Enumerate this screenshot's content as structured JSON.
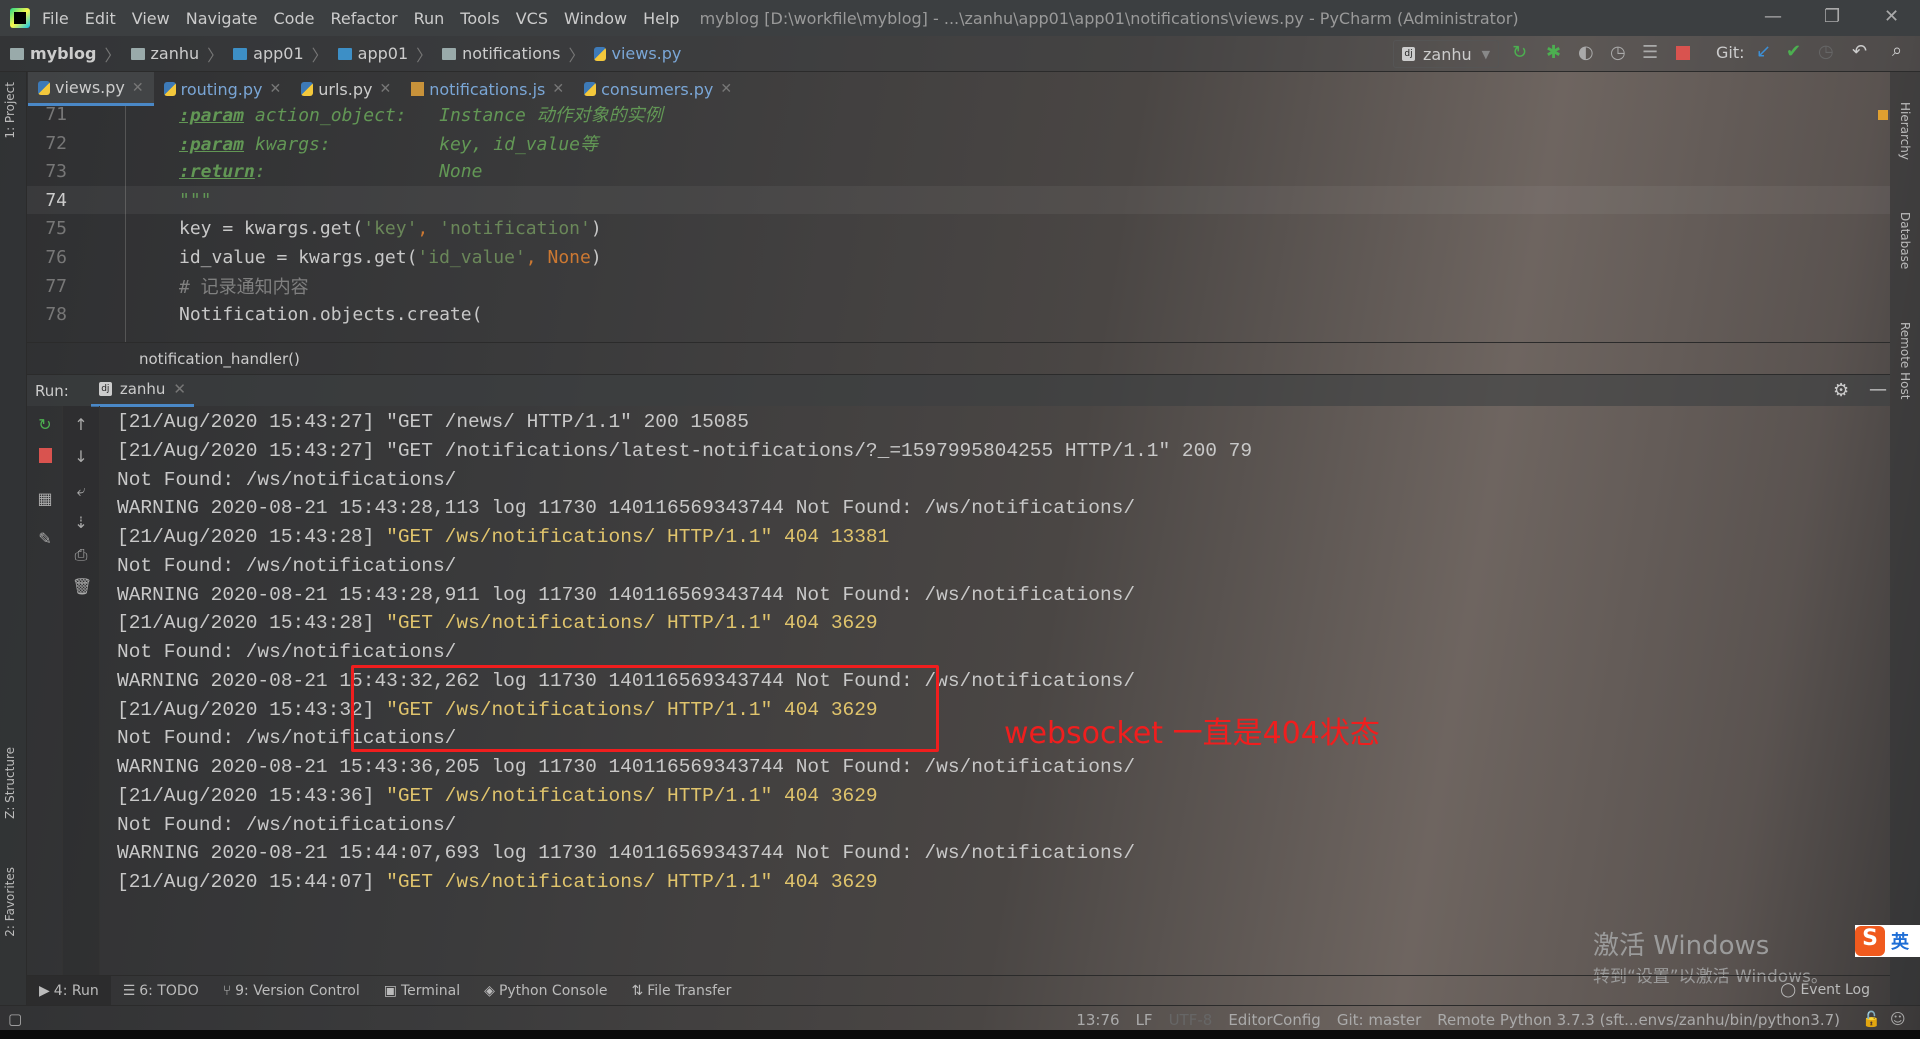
{
  "titlebar": {
    "menus": [
      "File",
      "Edit",
      "View",
      "Navigate",
      "Code",
      "Refactor",
      "Run",
      "Tools",
      "VCS",
      "Window",
      "Help"
    ],
    "title": "myblog [D:\\workfile\\myblog] - ...\\zanhu\\app01\\app01\\notifications\\views.py - PyCharm (Administrator)"
  },
  "navbar": {
    "crumbs": [
      "myblog",
      "zanhu",
      "app01",
      "app01",
      "notifications",
      "views.py"
    ],
    "run_config": "zanhu",
    "git_label": "Git:"
  },
  "tabs": [
    "views.py",
    "routing.py",
    "urls.py",
    "notifications.js",
    "consumers.py"
  ],
  "side": {
    "project": "1: Project",
    "structure": "Z: Structure",
    "favorites": "2: Favorites",
    "hierarchy": "Hierarchy",
    "database": "Database",
    "remote": "Remote Host"
  },
  "editor": {
    "lines": [
      {
        "n": "71",
        "parts": [
          [
            ":param",
            "tagu"
          ],
          [
            " action_object:   ",
            "doc"
          ],
          [
            "Instance 动作对象的实例",
            "doc"
          ]
        ]
      },
      {
        "n": "72",
        "parts": [
          [
            ":param",
            "tagu"
          ],
          [
            " kwargs:          ",
            "doc"
          ],
          [
            "key, id_value等",
            "doc"
          ]
        ]
      },
      {
        "n": "73",
        "parts": [
          [
            ":return",
            "tagu"
          ],
          [
            ":                ",
            "doc"
          ],
          [
            "None",
            "doc"
          ]
        ]
      },
      {
        "n": "74",
        "parts": [
          [
            "\"\"\"",
            "doc"
          ]
        ]
      },
      {
        "n": "75",
        "parts": [
          [
            "key = kwargs.get(",
            "txt"
          ],
          [
            "'key'",
            "str"
          ],
          [
            ", ",
            "kw"
          ],
          [
            "'notification'",
            "str"
          ],
          [
            ")",
            "txt"
          ]
        ]
      },
      {
        "n": "76",
        "parts": [
          [
            "id_value = kwargs.get(",
            "txt"
          ],
          [
            "'id_value'",
            "str"
          ],
          [
            ", ",
            "kw"
          ],
          [
            "None",
            "none"
          ],
          [
            ")",
            "txt"
          ]
        ]
      },
      {
        "n": "77",
        "parts": [
          [
            "# 记录通知内容",
            "cmt"
          ]
        ]
      },
      {
        "n": "78",
        "parts": [
          [
            "Notification.objects.create(",
            "txt"
          ]
        ]
      }
    ],
    "function": "notification_handler()"
  },
  "run": {
    "label": "Run:",
    "tab": "zanhu"
  },
  "console": [
    [
      "[21/Aug/2020 15:43:27] \"GET /news/ HTTP/1.1\" 200 15085",
      ""
    ],
    [
      "[21/Aug/2020 15:43:27] \"GET /notifications/latest-notifications/?_=1597995804255 HTTP/1.1\" 200 79",
      ""
    ],
    [
      "Not Found: /ws/notifications/",
      ""
    ],
    [
      "WARNING 2020-08-21 15:43:28,113 log 11730 140116569343744 Not Found: /ws/notifications/",
      ""
    ],
    [
      "[21/Aug/2020 15:43:28] ",
      "\"GET /ws/notifications/ HTTP/1.1\" 404 13381"
    ],
    [
      "Not Found: /ws/notifications/",
      ""
    ],
    [
      "WARNING 2020-08-21 15:43:28,911 log 11730 140116569343744 Not Found: /ws/notifications/",
      ""
    ],
    [
      "[21/Aug/2020 15:43:28] ",
      "\"GET /ws/notifications/ HTTP/1.1\" 404 3629"
    ],
    [
      "Not Found: /ws/notifications/",
      ""
    ],
    [
      "WARNING 2020-08-21 15:43:32,262 log 11730 140116569343744 Not Found: /ws/notifications/",
      ""
    ],
    [
      "[21/Aug/2020 15:43:32] ",
      "\"GET /ws/notifications/ HTTP/1.1\" 404 3629"
    ],
    [
      "Not Found: /ws/notifications/",
      ""
    ],
    [
      "WARNING 2020-08-21 15:43:36,205 log 11730 140116569343744 Not Found: /ws/notifications/",
      ""
    ],
    [
      "[21/Aug/2020 15:43:36] ",
      "\"GET /ws/notifications/ HTTP/1.1\" 404 3629"
    ],
    [
      "Not Found: /ws/notifications/",
      ""
    ],
    [
      "WARNING 2020-08-21 15:44:07,693 log 11730 140116569343744 Not Found: /ws/notifications/",
      ""
    ],
    [
      "[21/Aug/2020 15:44:07] ",
      "\"GET /ws/notifications/ HTTP/1.1\" 404 3629"
    ]
  ],
  "annotation": "websocket 一直是404状态",
  "bottombar": {
    "items": [
      "4: Run",
      "6: TODO",
      "9: Version Control",
      "Terminal",
      "Python Console",
      "File Transfer"
    ],
    "event_log": "Event Log"
  },
  "status": {
    "pos": "13:76",
    "eol": "LF",
    "enc": "UTF-8",
    "cfg": "EditorConfig",
    "git": "Git: master",
    "interp": "Remote Python 3.7.3 (sft...envs/zanhu/bin/python3.7)"
  },
  "watermark": {
    "line1": "激活 Windows",
    "line2": "转到“设置”以激活 Windows。"
  },
  "ime": {
    "logo": "S",
    "mode": "英"
  },
  "colors": {
    "annotation": "#f01e1e",
    "accent": "#4a88c7",
    "log_highlight": "#e0c46c"
  }
}
